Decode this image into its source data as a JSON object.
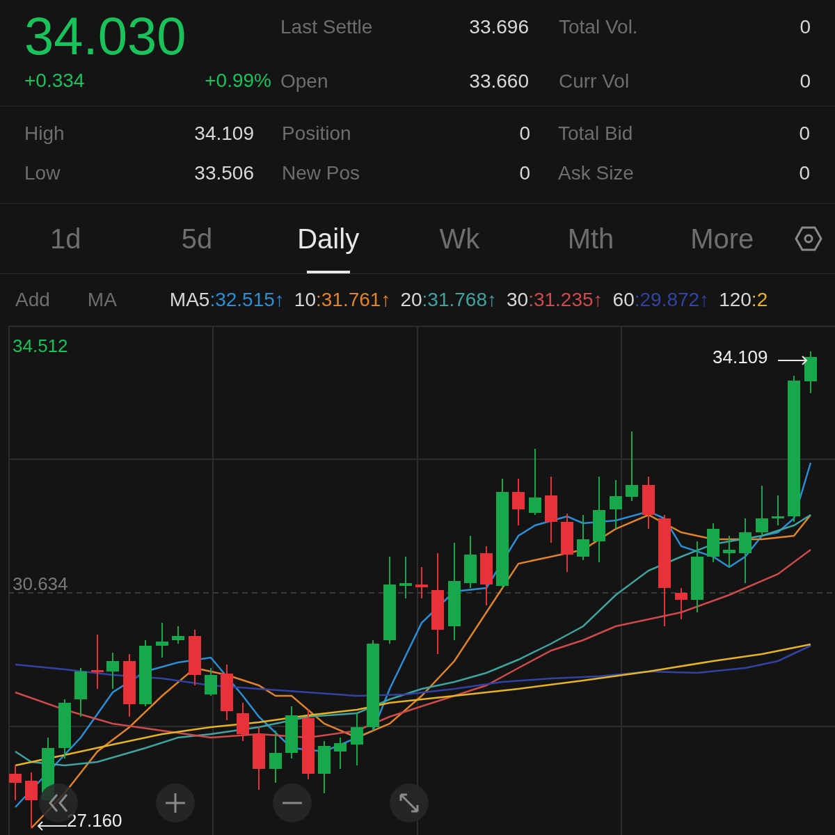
{
  "quote": {
    "price": "34.030",
    "change": "+0.334",
    "change_pct": "+0.99%"
  },
  "stats_top": [
    {
      "label": "Last Settle",
      "value": "33.696"
    },
    {
      "label": "Total Vol.",
      "value": "0"
    },
    {
      "label": "Open",
      "value": "33.660"
    },
    {
      "label": "Curr Vol",
      "value": "0"
    }
  ],
  "stats_bottom": [
    {
      "label": "High",
      "value": "34.109"
    },
    {
      "label": "Position",
      "value": "0"
    },
    {
      "label": "Total Bid",
      "value": "0"
    },
    {
      "label": "Low",
      "value": "33.506"
    },
    {
      "label": "New Pos",
      "value": "0"
    },
    {
      "label": "Ask Size",
      "value": "0"
    }
  ],
  "tabs": [
    {
      "label": "1d",
      "selected": false
    },
    {
      "label": "5d",
      "selected": false
    },
    {
      "label": "Daily",
      "selected": true
    },
    {
      "label": "Wk",
      "selected": false
    },
    {
      "label": "Mth",
      "selected": false
    },
    {
      "label": "More",
      "selected": false
    }
  ],
  "indicator_bar": {
    "add": "Add",
    "ma": "MA"
  },
  "moving_averages": [
    {
      "name": "MA5",
      "sep": ":",
      "value": "32.515",
      "arrow": "↑",
      "color": "#2a8fd6"
    },
    {
      "name": "10",
      "sep": ":",
      "value": "31.761",
      "arrow": "↑",
      "color": "#e0832a"
    },
    {
      "name": "20",
      "sep": ":",
      "value": "31.768",
      "arrow": "↑",
      "color": "#3fa3a0"
    },
    {
      "name": "30",
      "sep": ":",
      "value": "31.235",
      "arrow": "↑",
      "color": "#cf4a4a"
    },
    {
      "name": "60",
      "sep": ":",
      "value": "29.872",
      "arrow": "↑",
      "color": "#3243a6"
    },
    {
      "name": "120",
      "sep": ":",
      "value": "2",
      "color": "#e6b422"
    }
  ],
  "chart": {
    "top_label": "34.512",
    "mid_label": "30.634",
    "high_marker": "34.109",
    "low_marker": "27.160"
  }
}
